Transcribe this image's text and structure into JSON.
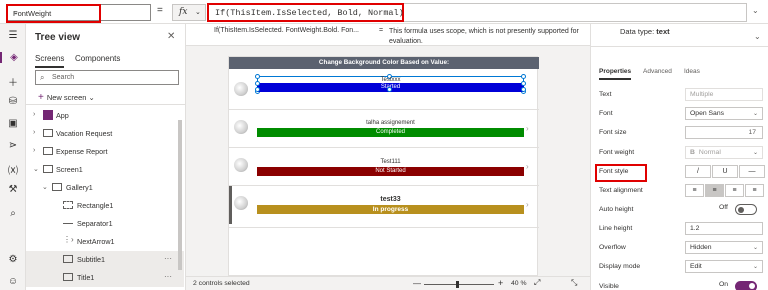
{
  "formula_bar": {
    "property": "FontWeight",
    "equals": "=",
    "fx": "fx",
    "formula": "If(ThisItem.IsSelected, Bold, Normal)"
  },
  "formula_info": {
    "preview": "If(ThisItem.IsSelected. FontWeight.Bold. Fon...",
    "eq": "=",
    "message": "This formula uses scope, which is not presently supported for evaluation.",
    "data_type_label": "Data type:",
    "data_type_value": "text"
  },
  "tree": {
    "title": "Tree view",
    "tabs": [
      "Screens",
      "Components"
    ],
    "search_placeholder": "Search",
    "new_screen": "New screen",
    "nodes": [
      {
        "label": "App",
        "icon": "app-icon"
      },
      {
        "label": "Vacation Request",
        "icon": "screen-icon"
      },
      {
        "label": "Expense Report",
        "icon": "screen-icon"
      },
      {
        "label": "Screen1",
        "icon": "screen-icon"
      },
      {
        "label": "Gallery1",
        "icon": "gallery-icon"
      },
      {
        "label": "Rectangle1",
        "icon": "rectangle-icon"
      },
      {
        "label": "Separator1",
        "icon": "separator-icon"
      },
      {
        "label": "NextArrow1",
        "icon": "next-arrow-icon"
      },
      {
        "label": "Subtitle1",
        "icon": "label-icon"
      },
      {
        "label": "Title1",
        "icon": "label-icon"
      }
    ],
    "more": "···"
  },
  "screen": {
    "header": "Change Background Color Based on Value:",
    "items": [
      {
        "title": "Testxxx",
        "status": "Started"
      },
      {
        "title": "talha assignement",
        "status": "Completed"
      },
      {
        "title": "Test111",
        "status": "Not Started"
      },
      {
        "title": "test33",
        "status": "In progress"
      }
    ],
    "colors": {
      "Started": "#0000d8",
      "Completed": "#008c00",
      "Not Started": "#8b0000",
      "In progress": "#b8901e"
    }
  },
  "properties": {
    "tabs": [
      "Properties",
      "Advanced",
      "Ideas"
    ],
    "text_label": "Text",
    "text_value": "Multiple",
    "font_label": "Font",
    "font_value": "Open Sans",
    "font_size_label": "Font size",
    "font_size_value": "17",
    "font_weight_label": "Font weight",
    "font_weight_value": "Normal",
    "font_style_label": "Font style",
    "font_style_buttons": [
      "/",
      "U",
      "—"
    ],
    "text_alignment_label": "Text alignment",
    "auto_height_label": "Auto height",
    "auto_height_value": "Off",
    "line_height_label": "Line height",
    "line_height_value": "1.2",
    "overflow_label": "Overflow",
    "overflow_value": "Hidden",
    "display_mode_label": "Display mode",
    "display_mode_value": "Edit",
    "visible_label": "Visible",
    "visible_value": "On"
  },
  "status": {
    "selection": "2 controls selected",
    "zoom_minus": "—",
    "zoom_plus": "+",
    "zoom_value": "40",
    "zoom_unit": "%",
    "zoom_fraction": 0.45
  },
  "accent_color": "#742774"
}
